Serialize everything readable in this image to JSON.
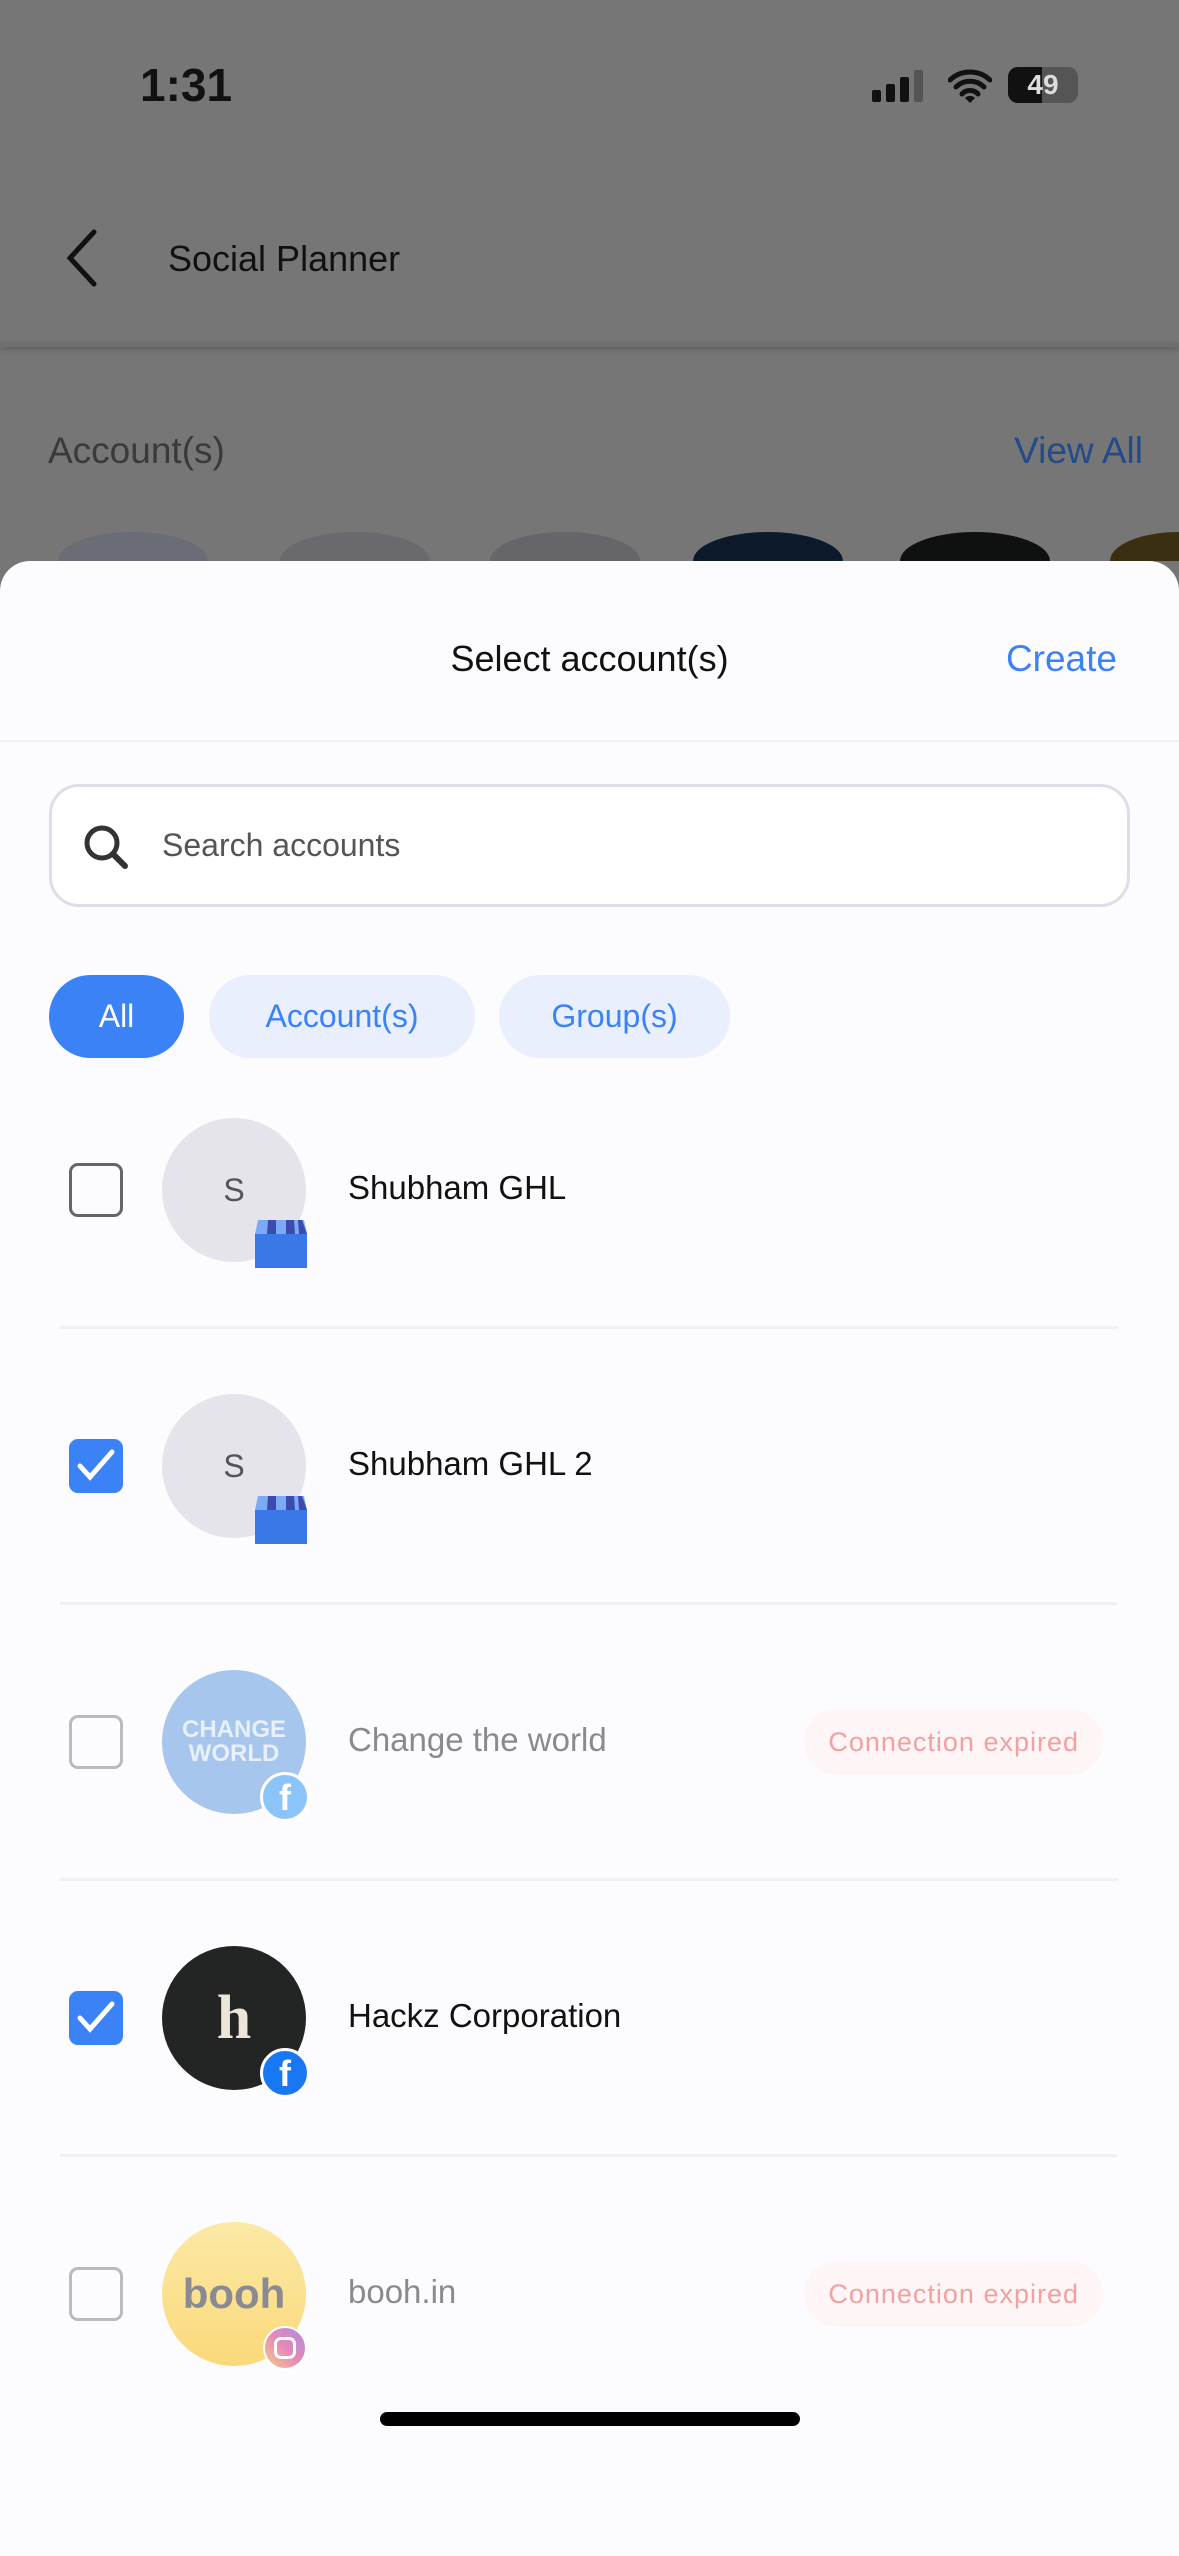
{
  "status_bar": {
    "time": "1:31",
    "battery": "49"
  },
  "background": {
    "header_title": "Social Planner",
    "section_label": "Account(s)",
    "view_all": "View All"
  },
  "sheet": {
    "title": "Select account(s)",
    "create_label": "Create",
    "search": {
      "placeholder": "Search accounts",
      "value": ""
    },
    "filters": [
      {
        "label": "All",
        "active": true
      },
      {
        "label": "Account(s)",
        "active": false
      },
      {
        "label": "Group(s)",
        "active": false
      }
    ],
    "accounts": [
      {
        "name": "Shubham GHL",
        "initial": "S",
        "platform": "google-business-icon",
        "checked": false,
        "status": ""
      },
      {
        "name": "Shubham GHL 2",
        "initial": "S",
        "platform": "google-business-icon",
        "checked": true,
        "status": ""
      },
      {
        "name": "Change the world",
        "avatar_text": "CHANGE WORLD",
        "platform": "facebook-icon",
        "checked": false,
        "status": "Connection expired"
      },
      {
        "name": "Hackz Corporation",
        "avatar_text": "h",
        "platform": "facebook-icon",
        "checked": true,
        "status": ""
      },
      {
        "name": "booh.in",
        "avatar_text": "booh",
        "platform": "instagram-icon",
        "checked": false,
        "status": "Connection expired"
      }
    ]
  },
  "colors": {
    "accent": "#3b82f6",
    "expired": "#f2a0a0"
  }
}
